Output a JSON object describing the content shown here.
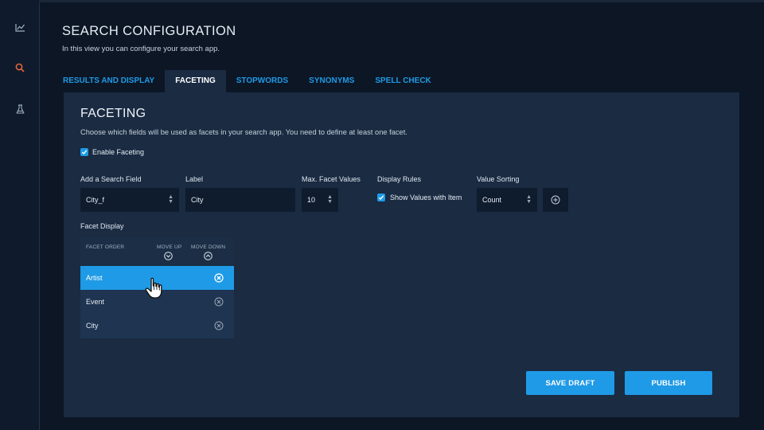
{
  "header": {
    "title": "SEARCH CONFIGURATION",
    "subtitle": "In this view you can configure your search app."
  },
  "sidebar": {
    "items": [
      {
        "icon": "chart-line-icon",
        "active": false
      },
      {
        "icon": "search-icon",
        "active": true
      },
      {
        "icon": "flask-icon",
        "active": false
      }
    ]
  },
  "tabs": [
    {
      "label": "RESULTS AND  DISPLAY",
      "active": false
    },
    {
      "label": "FACETING",
      "active": true
    },
    {
      "label": "STOPWORDS",
      "active": false
    },
    {
      "label": "SYNONYMS",
      "active": false
    },
    {
      "label": "SPELL CHECK",
      "active": false
    }
  ],
  "section": {
    "title": "FACETING",
    "description": "Choose which fields will be used as facets in your search app. You need to define at least one facet.",
    "enable_label": "Enable Faceting",
    "enable_checked": true
  },
  "form": {
    "search_field_label": "Add a Search Field",
    "search_field_value": "City_f",
    "label_label": "Label",
    "label_value": "City",
    "max_values_label": "Max. Facet Values",
    "max_values_value": "10",
    "display_rules_label": "Display Rules",
    "show_values_label": "Show Values with Item",
    "show_values_checked": true,
    "value_sorting_label": "Value Sorting",
    "value_sorting_value": "Count"
  },
  "facet_display": {
    "label": "Facet Display",
    "col_order": "FACET ORDER",
    "col_move_up": "MOVE UP",
    "col_move_down": "MOVE DOWN",
    "items": [
      {
        "name": "Artist",
        "selected": true
      },
      {
        "name": "Event",
        "selected": false
      },
      {
        "name": "City",
        "selected": false
      }
    ]
  },
  "actions": {
    "save_draft": "SAVE DRAFT",
    "publish": "PUBLISH"
  },
  "colors": {
    "accent": "#1f9ae6",
    "active_icon": "#e8663a",
    "background": "#0c1625",
    "panel": "#1a2b42"
  }
}
